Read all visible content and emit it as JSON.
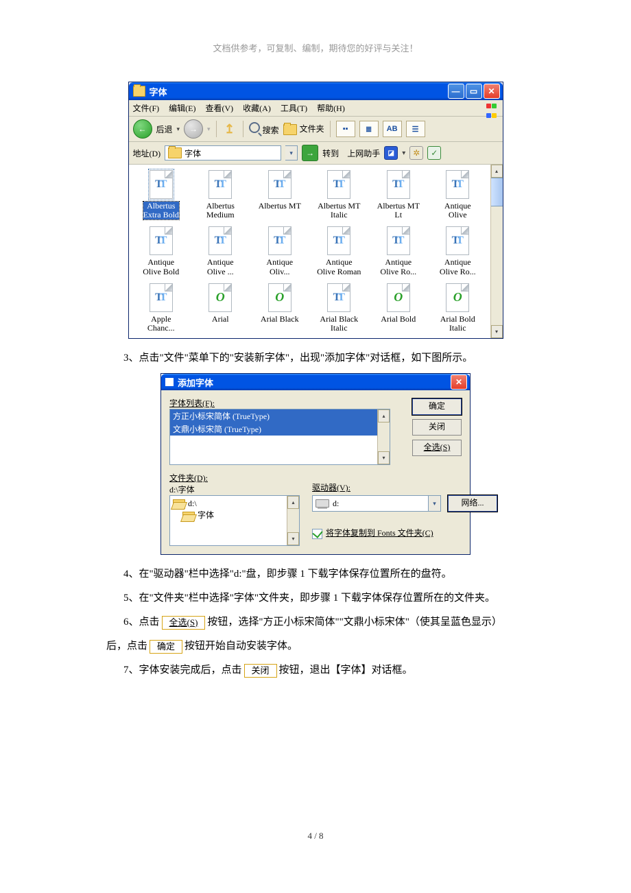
{
  "header_note": "文档供参考，可复制、编制，期待您的好评与关注！",
  "page_num": "4 / 8",
  "window1": {
    "title": "字体",
    "menu": {
      "file": "文件(F)",
      "edit": "编辑(E)",
      "view": "查看(V)",
      "fav": "收藏(A)",
      "tools": "工具(T)",
      "help": "帮助(H)"
    },
    "toolbar": {
      "back": "后退",
      "search": "搜索",
      "folders": "文件夹",
      "viewbtn_ab": "AB"
    },
    "addr": {
      "label": "地址(D)",
      "value": "字体",
      "go": "转到",
      "helper": "上网助手"
    },
    "fonts": [
      {
        "label": "Albertus\nExtra Bold",
        "type": "tt",
        "selected": true
      },
      {
        "label": "Albertus\nMedium",
        "type": "tt"
      },
      {
        "label": "Albertus MT",
        "type": "tt"
      },
      {
        "label": "Albertus MT\nItalic",
        "type": "tt"
      },
      {
        "label": "Albertus MT\nLt",
        "type": "tt"
      },
      {
        "label": "Antique\nOlive",
        "type": "tt"
      },
      {
        "label": "Antique\nOlive Bold",
        "type": "tt"
      },
      {
        "label": "Antique\nOlive ...",
        "type": "tt"
      },
      {
        "label": "Antique\nOliv...",
        "type": "tt"
      },
      {
        "label": "Antique\nOlive Roman",
        "type": "tt"
      },
      {
        "label": "Antique\nOlive Ro...",
        "type": "tt"
      },
      {
        "label": "Antique\nOlive Ro...",
        "type": "tt"
      },
      {
        "label": "Apple\nChanc...",
        "type": "tt"
      },
      {
        "label": "Arial",
        "type": "ot"
      },
      {
        "label": "Arial Black",
        "type": "ot"
      },
      {
        "label": "Arial Black\nItalic",
        "type": "tt"
      },
      {
        "label": "Arial Bold",
        "type": "ot"
      },
      {
        "label": "Arial Bold\nItalic",
        "type": "ot"
      }
    ]
  },
  "step3": "3、点击\"文件\"菜单下的\"安装新字体\"，出现\"添加字体\"对话框，如下图所示。",
  "dialog": {
    "title": "添加字体",
    "font_list_label": "字体列表(F):",
    "font_list": [
      "方正小标宋简体 (TrueType)",
      "文鼎小标宋简 (TrueType)"
    ],
    "ok": "确定",
    "close": "关闭",
    "select_all": "全选(S)",
    "folder_label": "文件夹(D):",
    "folder_path": "d:\\字体",
    "folder_tree": {
      "root": "d:\\",
      "child": "字体"
    },
    "drive_label": "驱动器(V):",
    "drive_value": "d:",
    "network": "网络...",
    "copy_check": "将字体复制到 Fonts 文件夹(C)"
  },
  "step4": "4、在\"驱动器\"栏中选择\"d:\"盘，即步骤 1 下载字体保存位置所在的盘符。",
  "step5": "5、在\"文件夹\"栏中选择\"字体\"文件夹，即步骤 1 下载字体保存位置所在的文件夹。",
  "step6a": "6、点击",
  "step6_btn1": "全选(S)",
  "step6b": "按钮，选择\"方正小标宋简体\"\"文鼎小标宋体\"（使其呈蓝色显示）",
  "step6c": "后，点击",
  "step6_btn2": "确定",
  "step6d": "按钮开始自动安装字体。",
  "step7a": "7、字体安装完成后，点击",
  "step7_btn": "关闭",
  "step7b": "按钮，退出【字体】对话框。"
}
